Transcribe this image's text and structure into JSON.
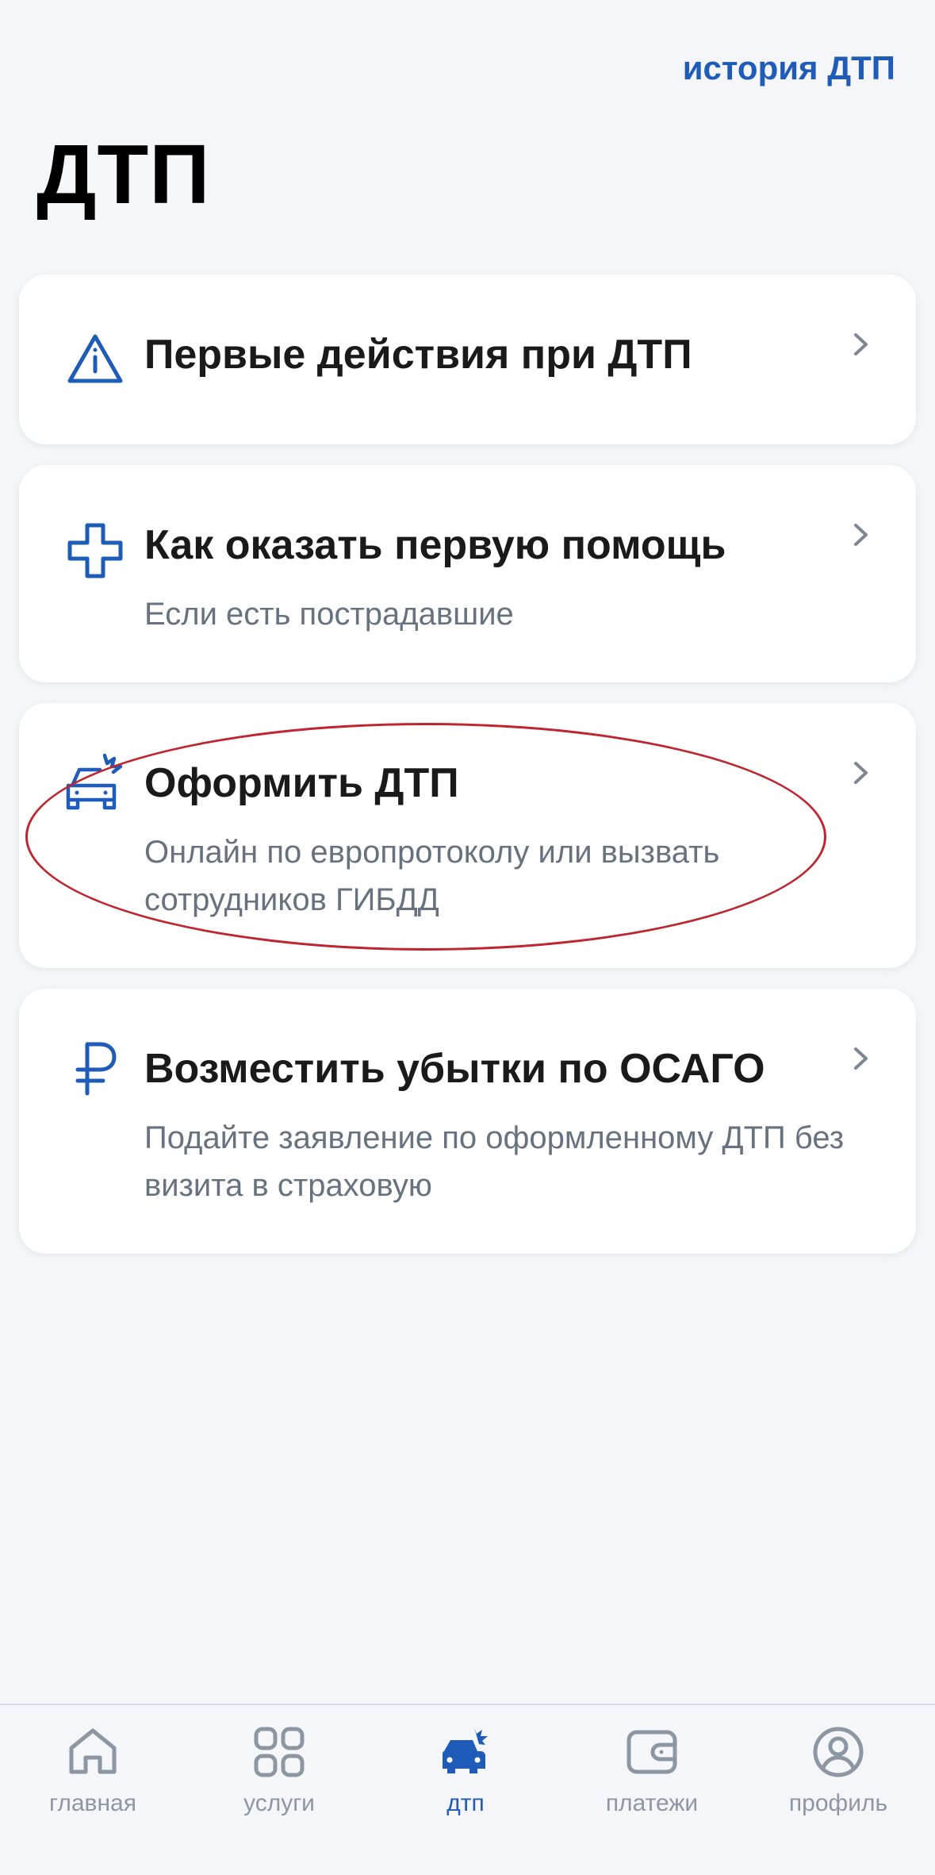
{
  "header": {
    "history_link": "история ДТП",
    "title": "ДТП"
  },
  "cards": [
    {
      "icon": "warning-triangle-icon",
      "title": "Первые действия при ДТП",
      "subtitle": ""
    },
    {
      "icon": "medical-cross-icon",
      "title": "Как оказать первую помощь",
      "subtitle": "Если есть пострадавшие"
    },
    {
      "icon": "car-crash-icon",
      "title": "Оформить ДТП",
      "subtitle": "Онлайн по европротоколу или вызвать сотрудников ГИБДД"
    },
    {
      "icon": "ruble-icon",
      "title": "Возместить убытки по ОСАГО",
      "subtitle": "Подайте заявление по оформленному ДТП без визита в страховую"
    }
  ],
  "tabs": [
    {
      "icon": "home-icon",
      "label": "главная",
      "active": false
    },
    {
      "icon": "grid-icon",
      "label": "услуги",
      "active": false
    },
    {
      "icon": "car-crash-icon",
      "label": "дтп",
      "active": true
    },
    {
      "icon": "wallet-icon",
      "label": "платежи",
      "active": false
    },
    {
      "icon": "profile-icon",
      "label": "профиль",
      "active": false
    }
  ],
  "colors": {
    "accent": "#1f5bb8",
    "background": "#f5f6f9",
    "card": "#ffffff",
    "title_text": "#1a1a1a",
    "secondary_text": "#66727f",
    "tab_inactive": "#8d97a3",
    "annotation": "#c0242e"
  }
}
